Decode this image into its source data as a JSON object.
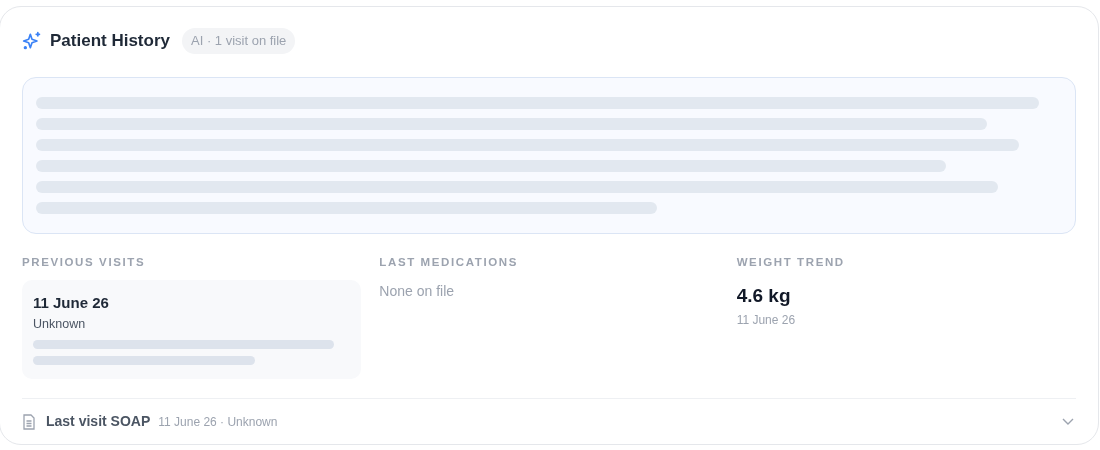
{
  "header": {
    "title": "Patient History",
    "badge": "AI · 1 visit on file"
  },
  "sections": [
    {
      "kind": "visits",
      "heading": "PREVIOUS VISITS",
      "visits": [
        {
          "date": "11 June 26",
          "vet": "Unknown"
        }
      ]
    },
    {
      "kind": "text",
      "heading": "LAST MEDICATIONS",
      "text": "None on file"
    },
    {
      "kind": "weight",
      "heading": "WEIGHT TREND",
      "value": "4.6 kg",
      "date": "11 June 26"
    }
  ],
  "soap": {
    "title": "Last visit SOAP",
    "meta": "11 June 26 · Unknown",
    "expanded": false
  }
}
